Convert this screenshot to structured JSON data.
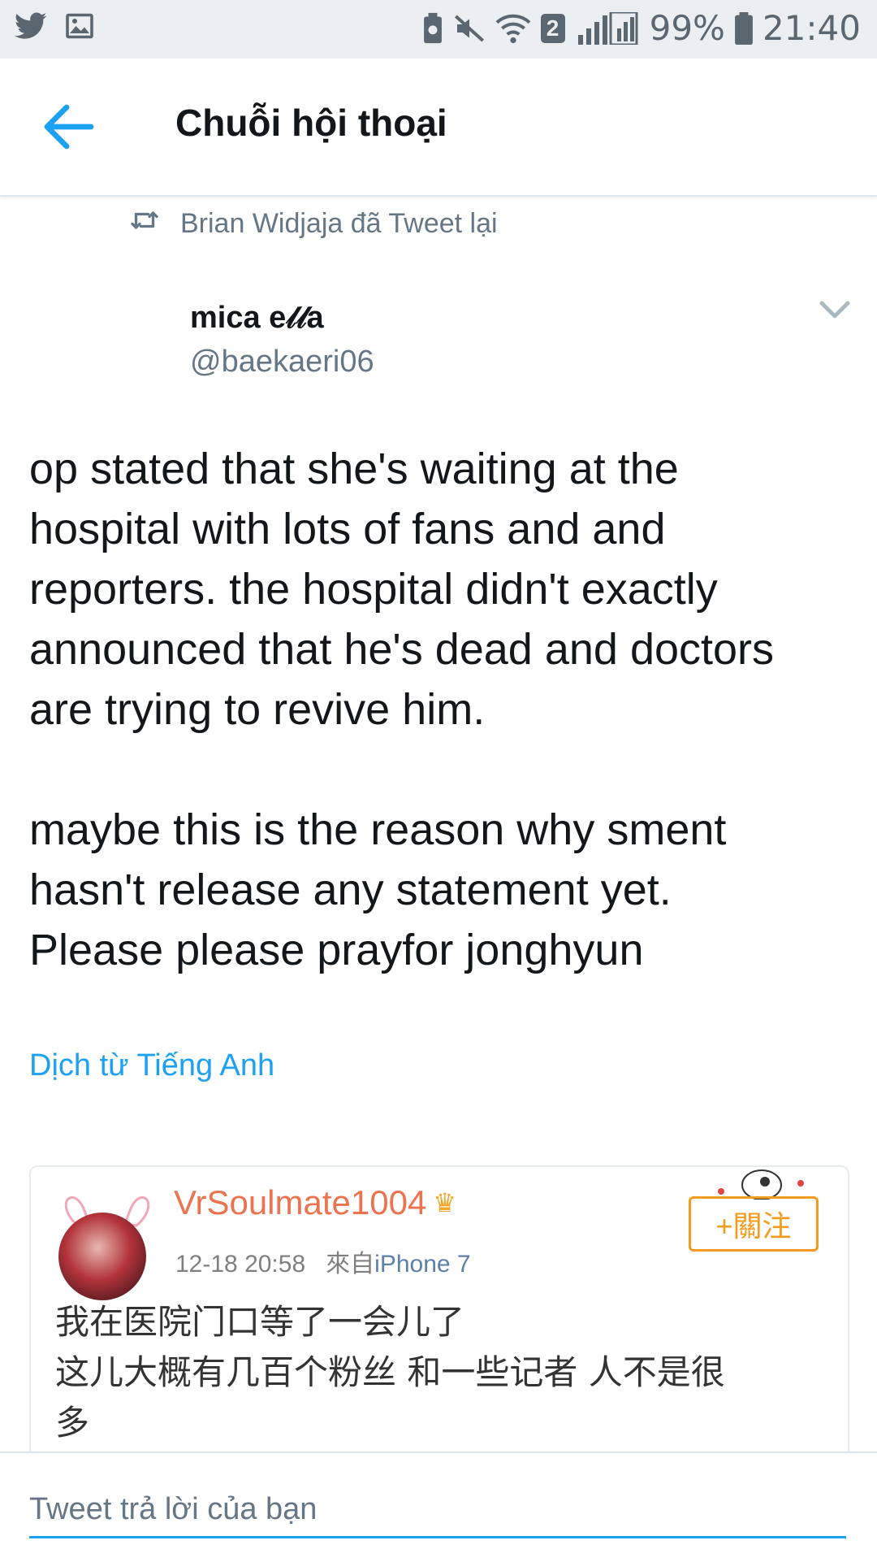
{
  "status_bar": {
    "battery": "99%",
    "time": "21:40",
    "network_badge": "2",
    "icons": [
      "twitter-icon",
      "image-icon",
      "battery-saver-icon",
      "mute-icon",
      "wifi-icon",
      "signal-icon",
      "battery-icon"
    ]
  },
  "header": {
    "title": "Chuỗi hội thoại"
  },
  "retweet": {
    "label": "Brian Widjaja đã Tweet lại"
  },
  "tweet": {
    "author_name": "mica e𝓁𝓁a",
    "author_handle": "@baekaeri06",
    "text": "op stated that she's waiting at the\nhospital with lots of fans and and\nreporters. the hospital didn't exactly\nannounced that he's dead and doctors\nare trying to revive him.\n\nmaybe this is the reason why sment\nhasn't release any statement yet.\nPlease please prayfor jonghyun",
    "translate_link": "Dịch từ Tiếng Anh"
  },
  "embedded_card": {
    "username": "VrSoulmate1004",
    "timestamp": "12-18 20:58",
    "source_prefix": "來自",
    "source": "iPhone 7",
    "follow_label": "+關注",
    "text": "我在医院门口等了一会儿了\n这儿大概有几百个粉丝 和一些记者 人不是很\n多"
  },
  "reply": {
    "placeholder": "Tweet trả lời của bạn"
  },
  "colors": {
    "accent": "#1da1f2",
    "weibo_orange": "#eb7350",
    "follow_orange": "#f39b1c",
    "secondary_text": "#657786"
  }
}
